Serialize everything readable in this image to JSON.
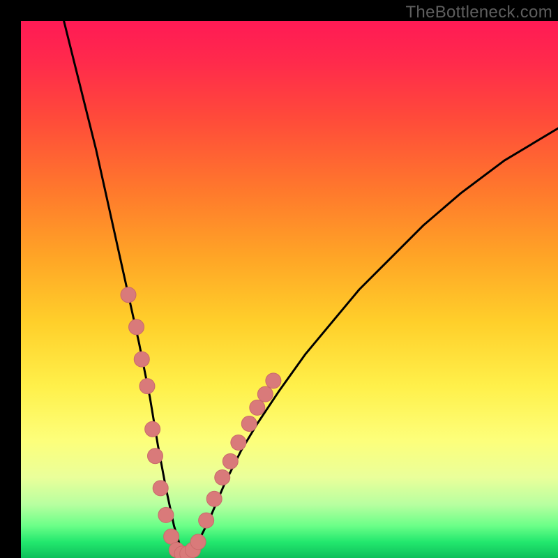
{
  "watermark": "TheBottleneck.com",
  "colors": {
    "curve_stroke": "#000000",
    "marker_fill": "#d97a7a",
    "marker_stroke": "#c96a6a"
  },
  "chart_data": {
    "type": "line",
    "title": "",
    "xlabel": "",
    "ylabel": "",
    "xlim": [
      0,
      100
    ],
    "ylim": [
      0,
      100
    ],
    "grid": false,
    "series": [
      {
        "name": "bottleneck-curve",
        "x": [
          8,
          10,
          12,
          14,
          16,
          18,
          20,
          22,
          24,
          25.5,
          27,
          28.5,
          30,
          32,
          35,
          38,
          41,
          44,
          48,
          53,
          58,
          63,
          69,
          75,
          82,
          90,
          100
        ],
        "y": [
          100,
          92,
          84,
          76,
          67,
          58,
          49,
          40,
          30,
          21,
          13,
          6,
          1,
          1,
          7,
          14,
          20,
          25,
          31,
          38,
          44,
          50,
          56,
          62,
          68,
          74,
          80
        ]
      }
    ],
    "markers": {
      "name": "highlighted-points",
      "points": [
        {
          "x": 20.0,
          "y": 49
        },
        {
          "x": 21.5,
          "y": 43
        },
        {
          "x": 22.5,
          "y": 37
        },
        {
          "x": 23.5,
          "y": 32
        },
        {
          "x": 24.5,
          "y": 24
        },
        {
          "x": 25.0,
          "y": 19
        },
        {
          "x": 26.0,
          "y": 13
        },
        {
          "x": 27.0,
          "y": 8
        },
        {
          "x": 28.0,
          "y": 4
        },
        {
          "x": 29.0,
          "y": 1.5
        },
        {
          "x": 30.0,
          "y": 0.8
        },
        {
          "x": 31.0,
          "y": 0.8
        },
        {
          "x": 32.0,
          "y": 1.5
        },
        {
          "x": 33.0,
          "y": 3
        },
        {
          "x": 34.5,
          "y": 7
        },
        {
          "x": 36.0,
          "y": 11
        },
        {
          "x": 37.5,
          "y": 15
        },
        {
          "x": 39.0,
          "y": 18
        },
        {
          "x": 40.5,
          "y": 21.5
        },
        {
          "x": 42.5,
          "y": 25
        },
        {
          "x": 44.0,
          "y": 28
        },
        {
          "x": 45.5,
          "y": 30.5
        },
        {
          "x": 47.0,
          "y": 33
        }
      ]
    }
  }
}
